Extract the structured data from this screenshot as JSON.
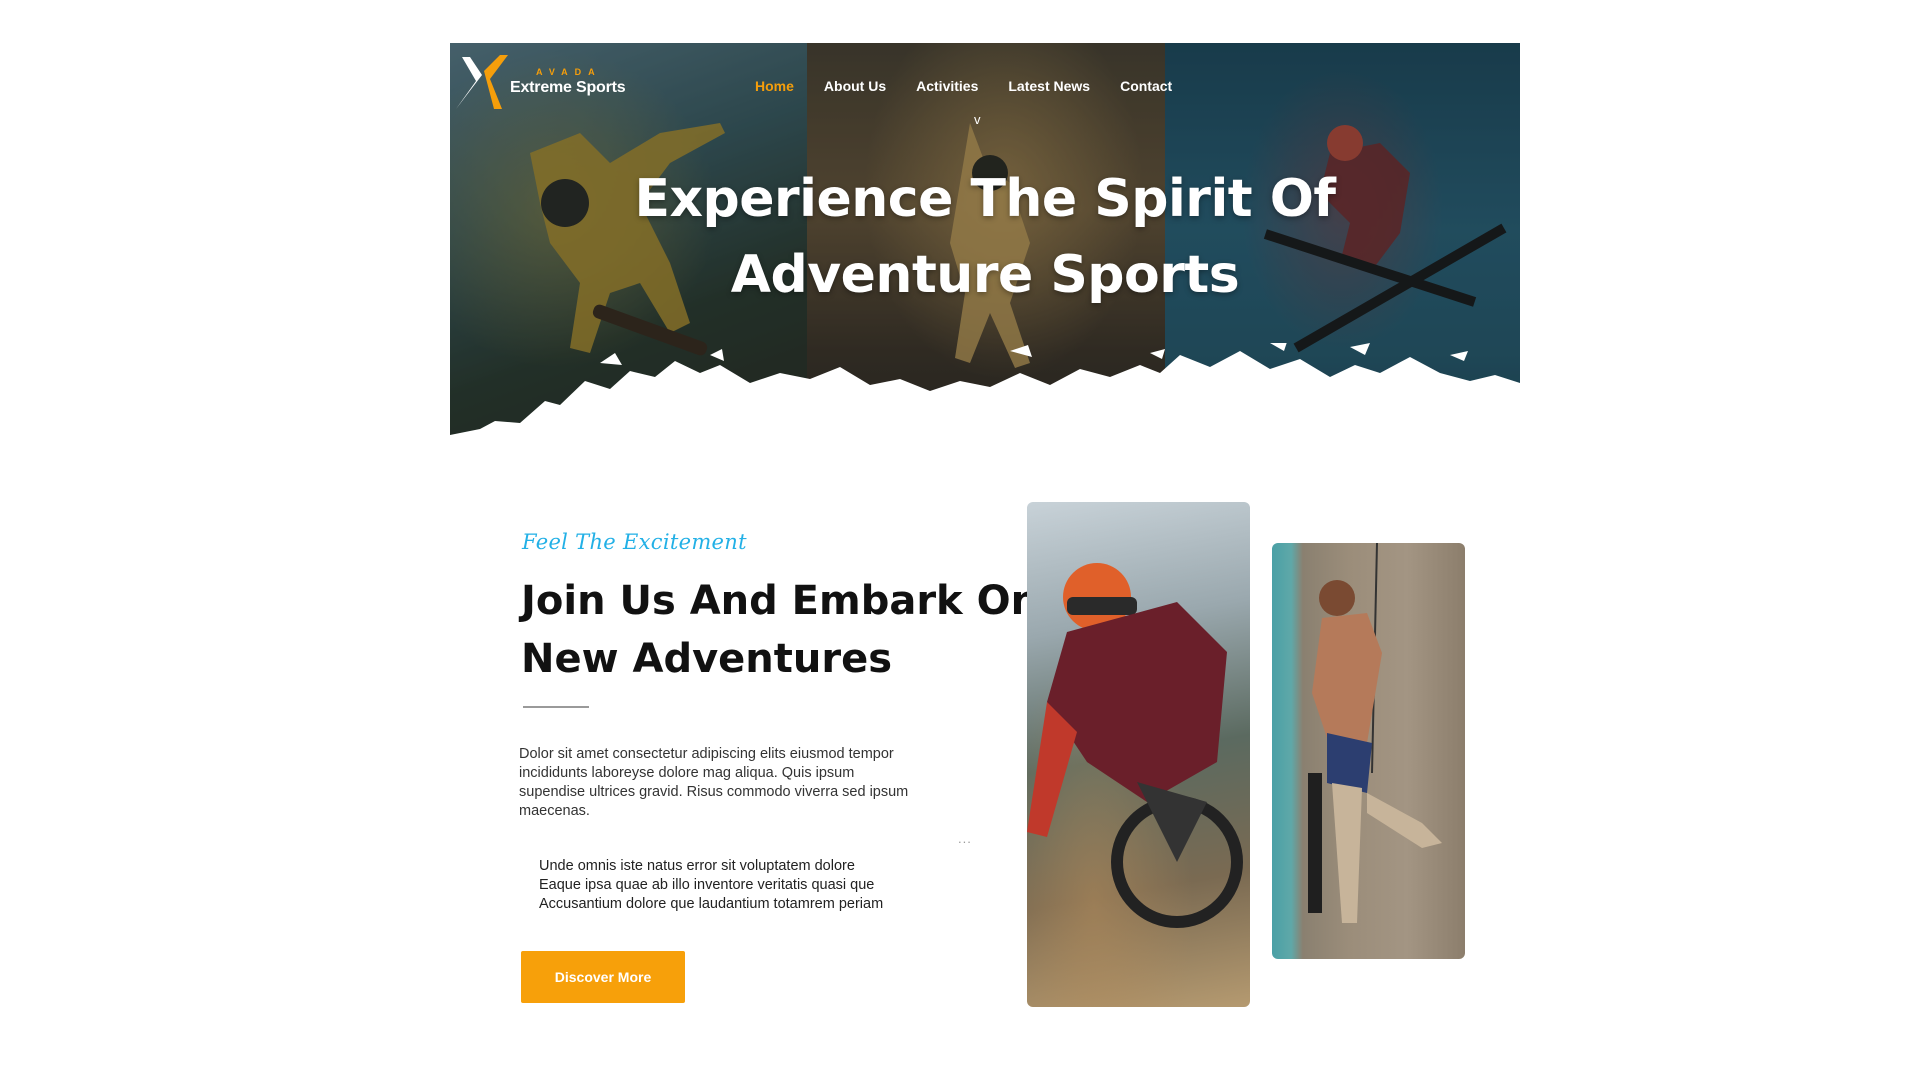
{
  "brand": {
    "small_label": "AVADA",
    "name": "Extreme Sports",
    "accent_color": "#f59e0b"
  },
  "nav": {
    "items": [
      {
        "label": "Home",
        "active": true
      },
      {
        "label": "About Us",
        "active": false
      },
      {
        "label": "Activities",
        "active": false
      },
      {
        "label": "Latest News",
        "active": false
      },
      {
        "label": "Contact",
        "active": false
      }
    ],
    "caret": "v"
  },
  "hero": {
    "title_line1": "Experience The Spirit Of",
    "title_line2": "Adventure Sports"
  },
  "intro": {
    "tagline": "Feel The Excitement",
    "heading_line1": "Join Us And Embark On",
    "heading_line2": "New Adventures",
    "paragraph_lines": [
      "Dolor sit amet consectetur adipiscing elits eiusmod tempor",
      "incididunts laboreyse dolore mag aliqua. Quis ipsum",
      "supendise ultrices gravid. Risus commodo viverra sed ipsum",
      "maecenas."
    ],
    "list_lines": [
      "Unde omnis iste natus error sit voluptatem dolore",
      "Eaque ipsa quae ab illo inventore veritatis quasi que",
      "Accusantium dolore que laudantium totamrem periam"
    ],
    "more_dots": "...",
    "button_label": "Discover More",
    "button_color": "#f7a00a",
    "tagline_color": "#22b0e6"
  },
  "icons": {
    "logo": "x-logo-icon"
  }
}
